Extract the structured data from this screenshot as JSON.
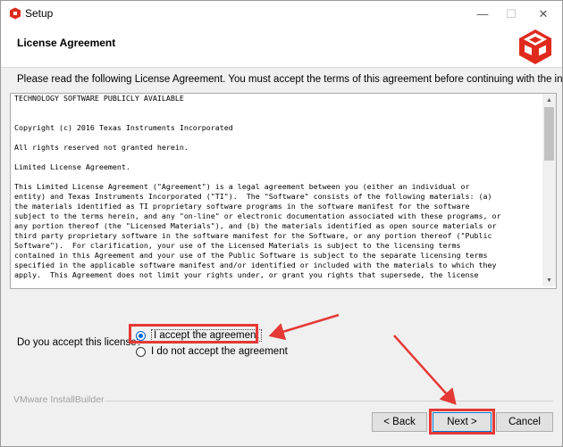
{
  "window": {
    "title": "Setup",
    "minimize_glyph": "—",
    "maximize_glyph": "☐",
    "close_glyph": "✕"
  },
  "header": {
    "title": "License Agreement",
    "logo_icon": "bitrock-cube-icon"
  },
  "instructions": "Please read the following License Agreement. You must accept the terms of this agreement before continuing with the installation.",
  "license_text": "TECHNOLOGY SOFTWARE PUBLICLY AVAILABLE\n\n\nCopyright (c) 2016 Texas Instruments Incorporated\n\nAll rights reserved not granted herein.\n\nLimited License Agreement.\n\nThis Limited License Agreement (\"Agreement\") is a legal agreement between you (either an individual or\nentity) and Texas Instruments Incorporated (\"TI\").  The \"Software\" consists of the following materials: (a)\nthe materials identified as TI proprietary software programs in the software manifest for the software\nsubject to the terms herein, and any \"on-line\" or electronic documentation associated with these programs, or\nany portion thereof (the \"Licensed Materials\"), and (b) the materials identified as open source materials or\nthird party proprietary software in the software manifest for the Software, or any portion thereof (\"Public\nSoftware\").  For clarification, your use of the Licensed Materials is subject to the licensing terms\ncontained in this Agreement and your use of the Public Software is subject to the separate licensing terms\nspecified in the applicable software manifest and/or identified or included with the materials to which they\napply.  This Agreement does not limit your rights under, or grant you rights that supersede, the license",
  "acceptance": {
    "question": "Do you accept this license?",
    "options": [
      {
        "label": "I accept the agreement",
        "selected": true
      },
      {
        "label": "I do not accept the agreement",
        "selected": false
      }
    ]
  },
  "footer": {
    "brand": "VMware InstallBuilder",
    "back_label": "< Back",
    "next_label": "Next >",
    "cancel_label": "Cancel"
  },
  "colors": {
    "annotation": "#e53935",
    "logo_red": "#e02a1e",
    "radio_accent": "#0064d6"
  }
}
